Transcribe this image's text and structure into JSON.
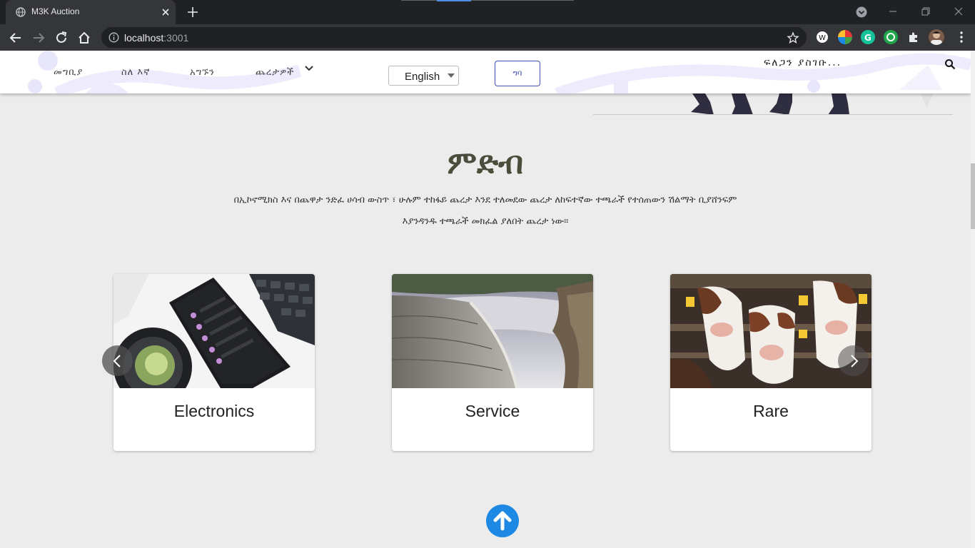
{
  "browser": {
    "tab_title": "M3K Auction",
    "url_host": "localhost",
    "url_port": ":3001"
  },
  "navbar": {
    "links": [
      "መግቢያ",
      "ስለ እኛ",
      "አግኙን",
      "ጨረታዎች"
    ],
    "language": "English",
    "login_label": "ግባ",
    "search_label": "ፍለጋን ያስገቡ..."
  },
  "section": {
    "title": "ምድብ",
    "line1": "በኢኮኖሚክስ እና በጨዋታ ንድፈ ሀሳብ ውስጥ ፣ ሁሉም ተከፋይ ጨረታ እንደ ተለመደው ጨረታ ለከፍተኛው ተጫራች የተሰጠውን ሽልማት ቢያሸንፍም",
    "line2": "እያንዳንዱ ተጫራች መክፈል ያለበት ጨረታ ነው።"
  },
  "cards": [
    {
      "title": "Electronics"
    },
    {
      "title": "Service"
    },
    {
      "title": "Rare"
    }
  ],
  "colors": {
    "accent": "#3f51b5",
    "scroll_top": "#1e88e5",
    "title": "#4c4c3c"
  }
}
